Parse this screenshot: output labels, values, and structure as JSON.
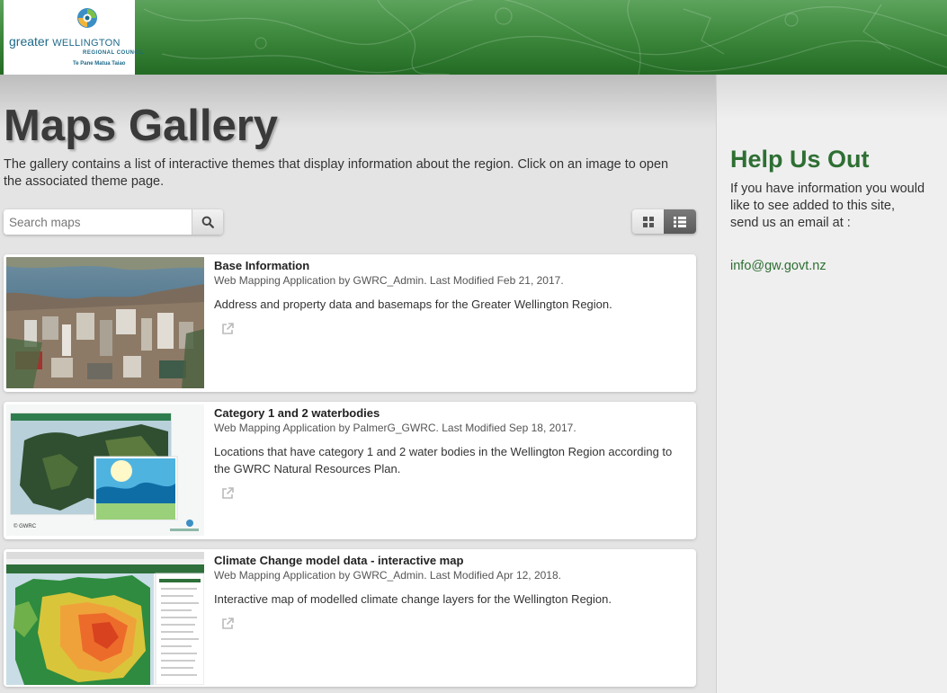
{
  "logo": {
    "brand_prefix": "greater",
    "brand_name": "WELLINGTON",
    "subtitle": "REGIONAL COUNCIL",
    "maori_name": "Te Pane Matua Taiao"
  },
  "page": {
    "title": "Maps Gallery",
    "intro": "The gallery contains a list of interactive themes that display information about the region. Click on an image to open the associated theme page."
  },
  "search": {
    "placeholder": "Search maps",
    "icon": "search-icon"
  },
  "view_toggle": {
    "grid_icon": "grid-view-icon",
    "list_icon": "list-view-icon",
    "active": "list"
  },
  "items": [
    {
      "title": "Base Information",
      "meta": "Web Mapping Application by GWRC_Admin. Last Modified Feb 21, 2017.",
      "description": "Address and property data and basemaps for the Greater Wellington Region.",
      "icon": "external-link-icon"
    },
    {
      "title": "Category 1 and 2 waterbodies",
      "meta": "Web Mapping Application by PalmerG_GWRC. Last Modified Sep 18, 2017.",
      "description": "Locations that have category 1 and 2 water bodies in the Wellington Region according to the GWRC Natural Resources Plan.",
      "thumb_caption": "© GWRC",
      "icon": "external-link-icon"
    },
    {
      "title": "Climate Change model data - interactive map",
      "meta": "Web Mapping Application by GWRC_Admin. Last Modified Apr 12, 2018.",
      "description": "Interactive map of modelled climate change layers for the Wellington Region.",
      "icon": "external-link-icon"
    }
  ],
  "sidebar": {
    "title": "Help Us Out",
    "text": "If you have information you would like to see added to this site,\nsend us an email at :",
    "email": "info@gw.govt.nz"
  },
  "colors": {
    "header_green": "#2f7a30",
    "accent_green": "#2e6f33",
    "page_bg": "#e4e4e4",
    "sidebar_bg": "#efefef"
  }
}
